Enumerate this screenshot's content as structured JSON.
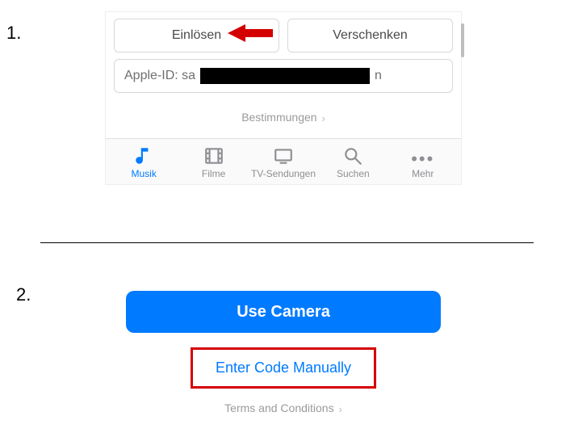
{
  "step1": {
    "number": "1.",
    "redeem_label": "Einlösen",
    "gift_label": "Verschenken",
    "apple_id_prefix": "Apple-ID: sa",
    "apple_id_suffix": "n",
    "terms_label": "Bestimmungen",
    "tabs": {
      "music": "Musik",
      "movies": "Filme",
      "tv": "TV-Sendungen",
      "search": "Suchen",
      "more": "Mehr"
    }
  },
  "step2": {
    "number": "2.",
    "camera_label": "Use Camera",
    "manual_label": "Enter Code Manually",
    "terms_label": "Terms and Conditions"
  },
  "colors": {
    "accent": "#007aff",
    "highlight": "#d40000"
  }
}
